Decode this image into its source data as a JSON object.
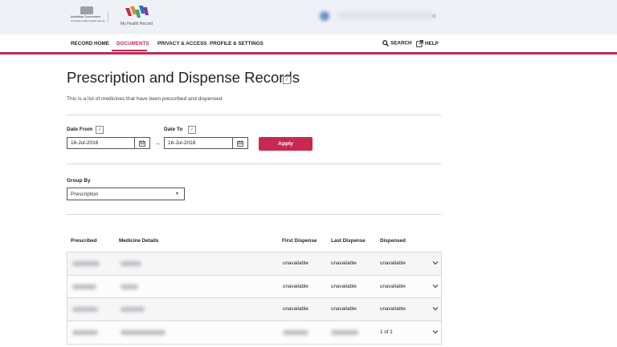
{
  "header": {
    "gov_line1": "Australian Government",
    "gov_line2": "Australian Digital Health Agency",
    "app_name": "My Health Record"
  },
  "nav": {
    "items": [
      {
        "label": "RECORD HOME"
      },
      {
        "label": "DOCUMENTS"
      },
      {
        "label": "PRIVACY & ACCESS"
      },
      {
        "label": "PROFILE & SETTINGS"
      }
    ],
    "search_label": "SEARCH",
    "help_label": "HELP",
    "active": "DOCUMENTS"
  },
  "page": {
    "title": "Prescription and Dispense Records",
    "subtitle": "This is a list of medicines that have been prescribed and dispensed."
  },
  "filters": {
    "date_from_label": "Date From",
    "date_from_value": "16-Jul-2016",
    "date_to_label": "Date To",
    "date_to_value": "16-Jul-2018",
    "apply_label": "Apply",
    "group_by_label": "Group By",
    "group_by_value": "Prescription"
  },
  "table": {
    "headers": [
      "Prescribed",
      "Medicine Details",
      "First Dispense",
      "Last Dispense",
      "Dispensed"
    ],
    "rows": [
      {
        "first": "unavailable",
        "last": "unavailable",
        "dispensed": "unavailable"
      },
      {
        "first": "unavailable",
        "last": "unavailable",
        "dispensed": "unavailable"
      },
      {
        "first": "unavailable",
        "last": "unavailable",
        "dispensed": "unavailable"
      },
      {
        "first": "",
        "last": "",
        "dispensed": "1 of 1"
      }
    ]
  },
  "icons": {
    "info": "info-icon",
    "calendar": "calendar-icon",
    "chevron": "chevron-down-icon",
    "search": "search-icon",
    "help": "external-link-icon"
  },
  "colors": {
    "accent": "#c7294f",
    "header_bg": "#eef1f6"
  }
}
